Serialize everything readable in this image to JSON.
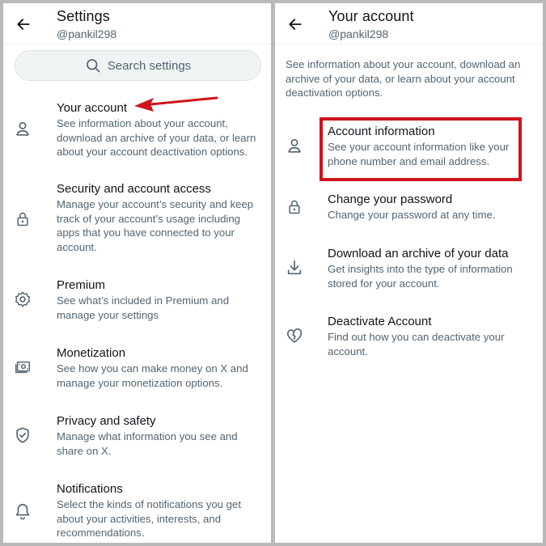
{
  "left": {
    "header": {
      "title": "Settings",
      "handle": "@pankil298"
    },
    "search": {
      "placeholder": "Search settings"
    },
    "items": [
      {
        "title": "Your account",
        "desc": "See information about your account, download an archive of your data, or learn about your account deactivation options.",
        "icon": "person-icon"
      },
      {
        "title": "Security and account access",
        "desc": "Manage your account’s security and keep track of your account’s usage including apps that you have connected to your account.",
        "icon": "lock-icon"
      },
      {
        "title": "Premium",
        "desc": "See what’s included in Premium and manage your settings",
        "icon": "gear-icon"
      },
      {
        "title": "Monetization",
        "desc": "See how you can make money on X and manage your monetization options.",
        "icon": "money-icon"
      },
      {
        "title": "Privacy and safety",
        "desc": "Manage what information you see and share on X.",
        "icon": "shield-icon"
      },
      {
        "title": "Notifications",
        "desc": "Select the kinds of notifications you get about your activities, interests, and recommendations.",
        "icon": "bell-icon"
      }
    ]
  },
  "right": {
    "header": {
      "title": "Your account",
      "handle": "@pankil298"
    },
    "intro": "See information about your account, download an archive of your data, or learn about your account deactivation options.",
    "items": [
      {
        "title": "Account information",
        "desc": "See your account information like your phone number and email address.",
        "icon": "person-icon"
      },
      {
        "title": "Change your password",
        "desc": "Change your password at any time.",
        "icon": "lock-icon"
      },
      {
        "title": "Download an archive of your data",
        "desc": "Get insights into the type of information stored for your account.",
        "icon": "download-icon"
      },
      {
        "title": "Deactivate Account",
        "desc": "Find out how you can deactivate your account.",
        "icon": "broken-heart-icon"
      }
    ]
  },
  "colors": {
    "annotation_red": "#d0121b",
    "secondary_text": "#536471",
    "primary_text": "#0f1419"
  }
}
